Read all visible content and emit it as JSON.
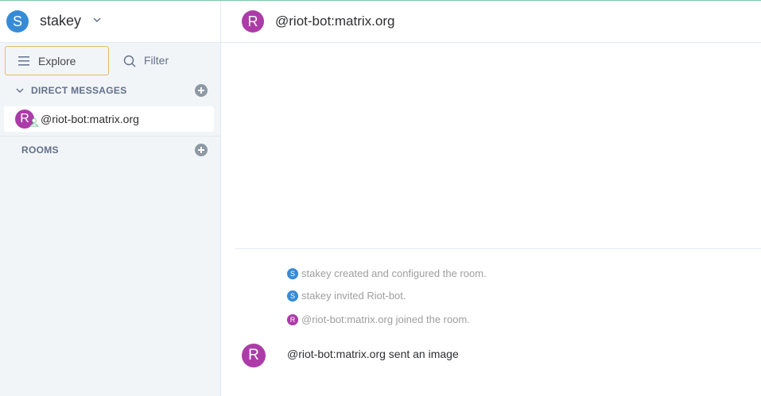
{
  "colors": {
    "accent_green": "#7ac9a1",
    "user_avatar": "#368bd6",
    "bot_avatar": "#ac3ba8",
    "focus_border": "#e7b86a",
    "sidebar_bg": "#f2f5f8"
  },
  "user": {
    "avatar_letter": "S",
    "name": "stakey",
    "menu_icon": "chevron-down-icon"
  },
  "toolbar": {
    "explore_label": "Explore",
    "explore_icon": "hamburger-icon",
    "filter_label": "Filter",
    "filter_icon": "search-icon"
  },
  "sidebar": {
    "direct_messages": {
      "label": "DIRECT MESSAGES",
      "items": [
        {
          "avatar_letter": "R",
          "label": "@riot-bot:matrix.org"
        }
      ]
    },
    "rooms": {
      "label": "ROOMS"
    }
  },
  "room": {
    "avatar_letter": "R",
    "name": "@riot-bot:matrix.org"
  },
  "timeline": {
    "events": [
      {
        "avatar_letter": "S",
        "avatar_color": "#368bd6",
        "text": "stakey created and configured the room."
      },
      {
        "avatar_letter": "S",
        "avatar_color": "#368bd6",
        "text": "stakey invited Riot-bot."
      },
      {
        "avatar_letter": "R",
        "avatar_color": "#ac3ba8",
        "text": "@riot-bot:matrix.org joined the room."
      }
    ],
    "message": {
      "avatar_letter": "R",
      "text": "@riot-bot:matrix.org sent an image"
    }
  }
}
